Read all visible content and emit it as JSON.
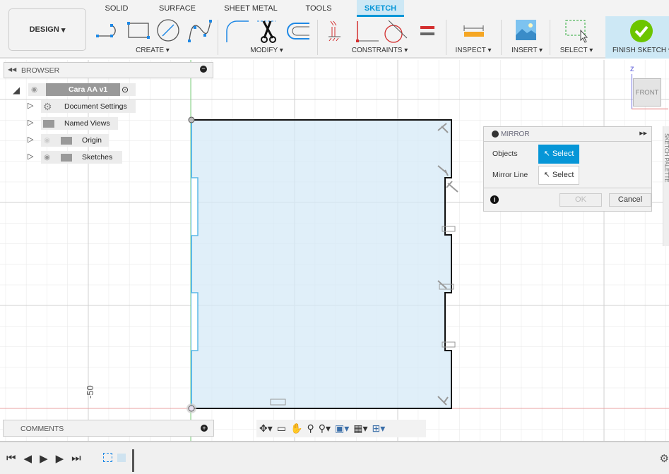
{
  "ribbon": {
    "tabs": [
      {
        "label": "SOLID"
      },
      {
        "label": "SURFACE"
      },
      {
        "label": "SHEET METAL"
      },
      {
        "label": "TOOLS"
      },
      {
        "label": "SKETCH",
        "active": true
      }
    ],
    "workspace": "DESIGN",
    "groups": {
      "create": "CREATE",
      "modify": "MODIFY",
      "constraints": "CONSTRAINTS",
      "inspect": "INSPECT",
      "insert": "INSERT",
      "select": "SELECT",
      "finish": "FINISH SKETCH"
    },
    "accent": "#0696d7",
    "finish_color": "#6cc500"
  },
  "browser": {
    "title": "BROWSER",
    "root": "Cara AA v1",
    "items": [
      {
        "label": "Document Settings",
        "icon": "gear-icon"
      },
      {
        "label": "Named Views",
        "icon": "folder-icon"
      },
      {
        "label": "Origin",
        "icon": "folder-icon"
      },
      {
        "label": "Sketches",
        "icon": "folder-icon"
      }
    ]
  },
  "comments": {
    "title": "COMMENTS"
  },
  "viewcube": {
    "face": "FRONT",
    "axis_z": "Z"
  },
  "dimension_label": "-50",
  "mirror": {
    "title": "MIRROR",
    "objects_label": "Objects",
    "objects_button": "Select",
    "mirror_line_label": "Mirror Line",
    "mirror_line_button": "Select",
    "ok": "OK",
    "cancel": "Cancel"
  },
  "sketch_palette": "SKETCH PALETTE"
}
